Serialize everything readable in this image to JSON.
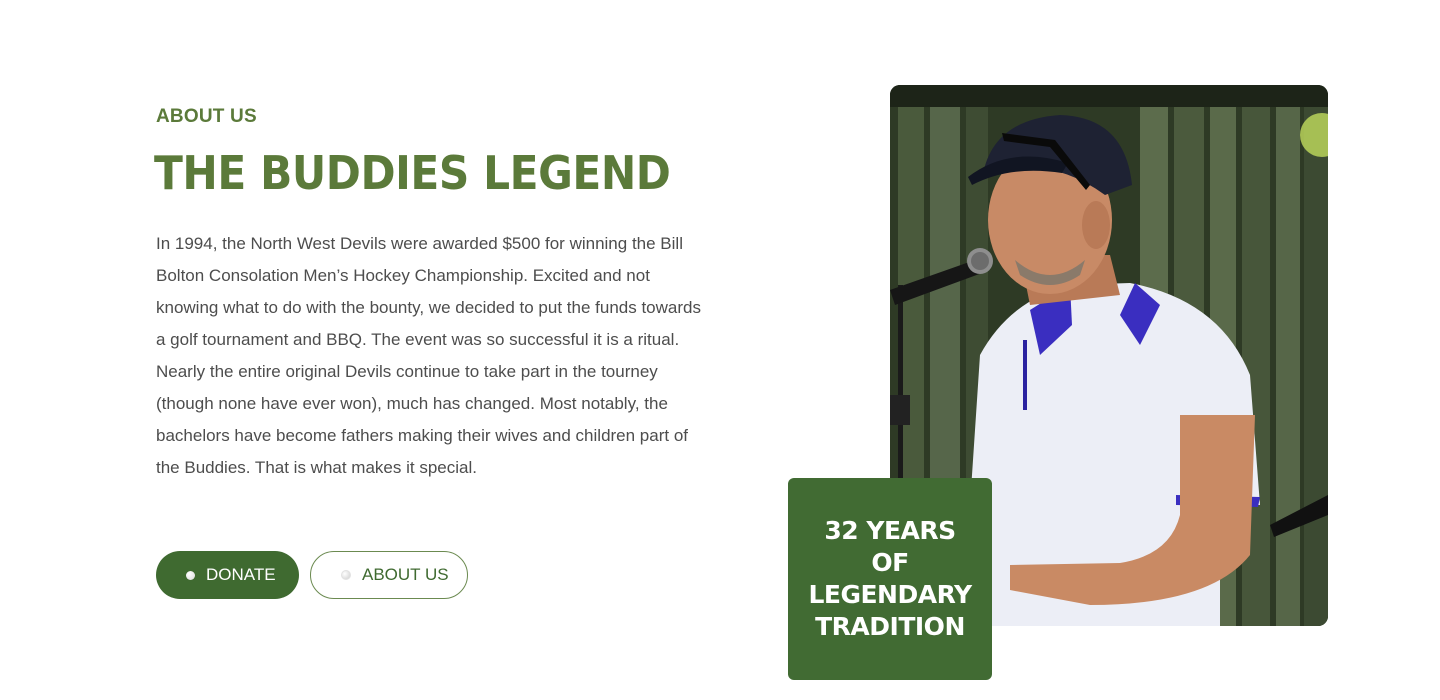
{
  "about": {
    "eyebrow": "ABOUT US",
    "title": "THE BUDDIES LEGEND",
    "paragraph": "In 1994, the North West Devils were awarded $500 for winning the Bill Bolton Consolation Men’s Hockey Championship. Excited and not knowing what to do with the bounty, we decided to put the funds towards a golf tournament and BBQ. The event was so successful it is a ritual. Nearly the entire original Devils continue to take part in the tourney (though none have ever won), much has changed. Most notably, the bachelors have become fathers making their wives and children part of the Buddies. That is what makes it special."
  },
  "buttons": {
    "donate_label": "DONATE",
    "about_label": "ABOUT US"
  },
  "badge": {
    "text": "32 YEARS\nOF\nLEGENDARY\nTRADITION"
  },
  "colors": {
    "accent_green": "#416b33",
    "heading_green": "#5b7a3a"
  }
}
